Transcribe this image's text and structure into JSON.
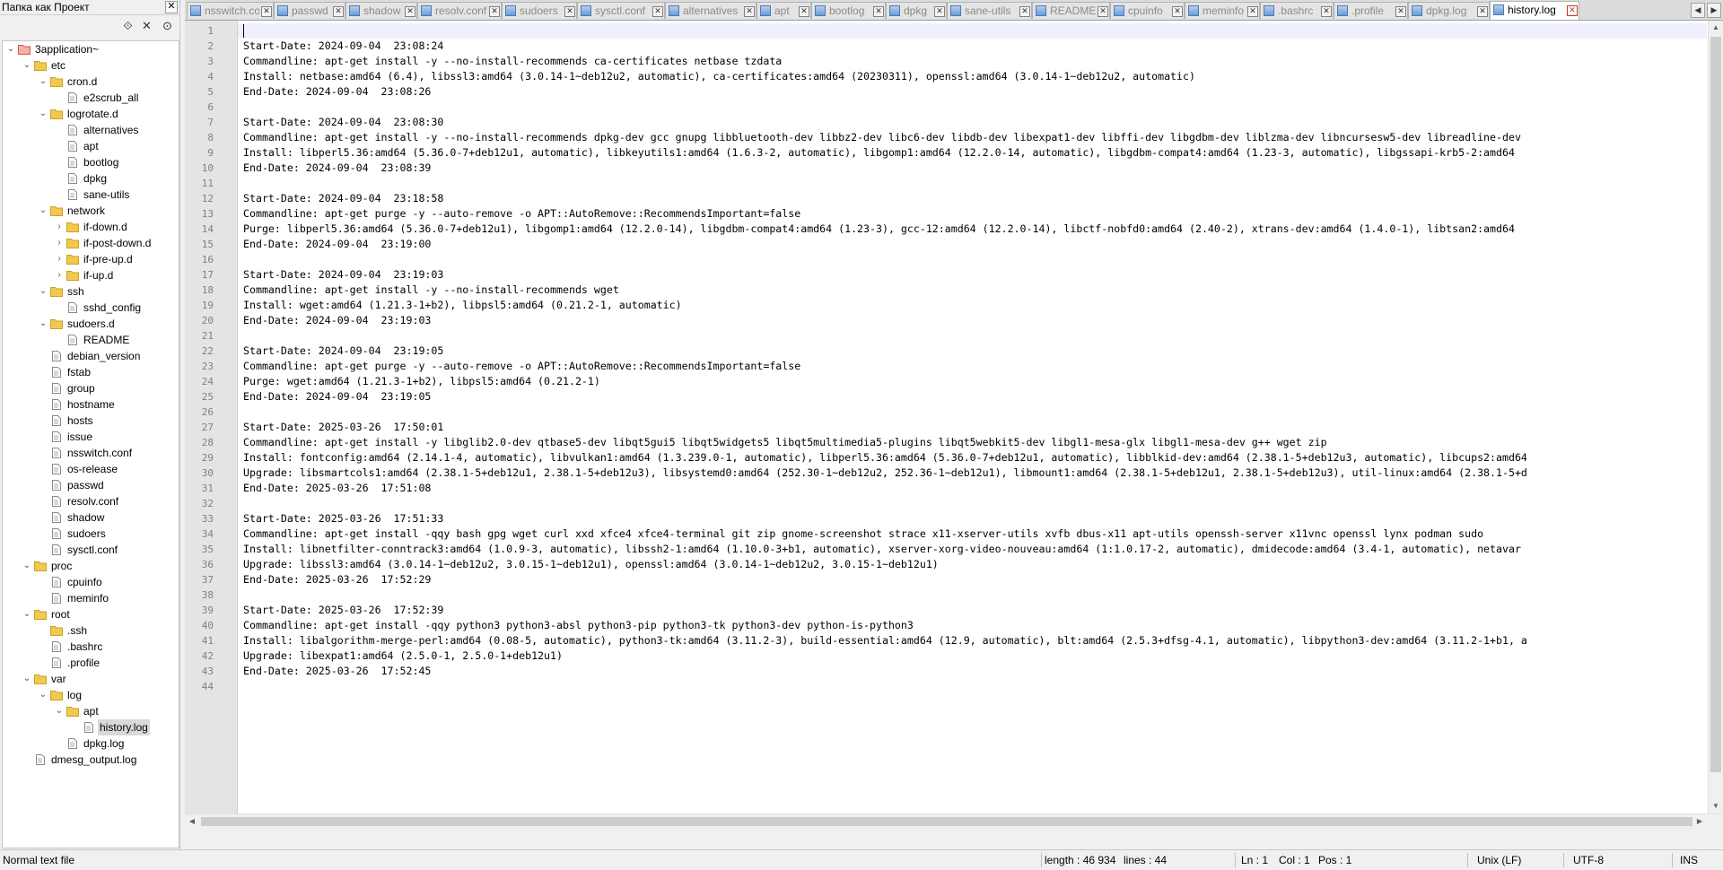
{
  "sidebar": {
    "title": "Папка как Проект",
    "close_glyph": "✕",
    "tree": [
      {
        "label": "3application~",
        "depth": 0,
        "type": "project",
        "toggle": "open"
      },
      {
        "label": "etc",
        "depth": 1,
        "type": "folder",
        "toggle": "open"
      },
      {
        "label": "cron.d",
        "depth": 2,
        "type": "folder",
        "toggle": "open"
      },
      {
        "label": "e2scrub_all",
        "depth": 3,
        "type": "file"
      },
      {
        "label": "logrotate.d",
        "depth": 2,
        "type": "folder",
        "toggle": "open"
      },
      {
        "label": "alternatives",
        "depth": 3,
        "type": "file"
      },
      {
        "label": "apt",
        "depth": 3,
        "type": "file"
      },
      {
        "label": "bootlog",
        "depth": 3,
        "type": "file"
      },
      {
        "label": "dpkg",
        "depth": 3,
        "type": "file"
      },
      {
        "label": "sane-utils",
        "depth": 3,
        "type": "file"
      },
      {
        "label": "network",
        "depth": 2,
        "type": "folder",
        "toggle": "open"
      },
      {
        "label": "if-down.d",
        "depth": 3,
        "type": "folder",
        "toggle": "closed"
      },
      {
        "label": "if-post-down.d",
        "depth": 3,
        "type": "folder",
        "toggle": "closed"
      },
      {
        "label": "if-pre-up.d",
        "depth": 3,
        "type": "folder",
        "toggle": "closed"
      },
      {
        "label": "if-up.d",
        "depth": 3,
        "type": "folder",
        "toggle": "closed"
      },
      {
        "label": "ssh",
        "depth": 2,
        "type": "folder",
        "toggle": "open"
      },
      {
        "label": "sshd_config",
        "depth": 3,
        "type": "file"
      },
      {
        "label": "sudoers.d",
        "depth": 2,
        "type": "folder",
        "toggle": "open"
      },
      {
        "label": "README",
        "depth": 3,
        "type": "file"
      },
      {
        "label": "debian_version",
        "depth": 2,
        "type": "file"
      },
      {
        "label": "fstab",
        "depth": 2,
        "type": "file"
      },
      {
        "label": "group",
        "depth": 2,
        "type": "file"
      },
      {
        "label": "hostname",
        "depth": 2,
        "type": "file"
      },
      {
        "label": "hosts",
        "depth": 2,
        "type": "file"
      },
      {
        "label": "issue",
        "depth": 2,
        "type": "file"
      },
      {
        "label": "nsswitch.conf",
        "depth": 2,
        "type": "file"
      },
      {
        "label": "os-release",
        "depth": 2,
        "type": "file"
      },
      {
        "label": "passwd",
        "depth": 2,
        "type": "file"
      },
      {
        "label": "resolv.conf",
        "depth": 2,
        "type": "file"
      },
      {
        "label": "shadow",
        "depth": 2,
        "type": "file"
      },
      {
        "label": "sudoers",
        "depth": 2,
        "type": "file"
      },
      {
        "label": "sysctl.conf",
        "depth": 2,
        "type": "file"
      },
      {
        "label": "proc",
        "depth": 1,
        "type": "folder",
        "toggle": "open"
      },
      {
        "label": "cpuinfo",
        "depth": 2,
        "type": "file"
      },
      {
        "label": "meminfo",
        "depth": 2,
        "type": "file"
      },
      {
        "label": "root",
        "depth": 1,
        "type": "folder",
        "toggle": "open"
      },
      {
        "label": ".ssh",
        "depth": 2,
        "type": "folder"
      },
      {
        "label": ".bashrc",
        "depth": 2,
        "type": "file"
      },
      {
        "label": ".profile",
        "depth": 2,
        "type": "file"
      },
      {
        "label": "var",
        "depth": 1,
        "type": "folder",
        "toggle": "open"
      },
      {
        "label": "log",
        "depth": 2,
        "type": "folder",
        "toggle": "open"
      },
      {
        "label": "apt",
        "depth": 3,
        "type": "folder",
        "toggle": "open"
      },
      {
        "label": "history.log",
        "depth": 4,
        "type": "file",
        "selected": true
      },
      {
        "label": "dpkg.log",
        "depth": 3,
        "type": "file"
      },
      {
        "label": "dmesg_output.log",
        "depth": 1,
        "type": "file"
      }
    ]
  },
  "tabs": [
    {
      "label": "nsswitch.conf",
      "width": 97
    },
    {
      "label": "passwd",
      "width": 80
    },
    {
      "label": "shadow",
      "width": 80
    },
    {
      "label": "resolv.conf",
      "width": 94
    },
    {
      "label": "sudoers",
      "width": 84
    },
    {
      "label": "sysctl.conf",
      "width": 98
    },
    {
      "label": "alternatives",
      "width": 102
    },
    {
      "label": "apt",
      "width": 61
    },
    {
      "label": "bootlog",
      "width": 83
    },
    {
      "label": "dpkg",
      "width": 68
    },
    {
      "label": "sane-utils",
      "width": 95
    },
    {
      "label": "README",
      "width": 87
    },
    {
      "label": "cpuinfo",
      "width": 83
    },
    {
      "label": "meminfo",
      "width": 84
    },
    {
      "label": ".bashrc",
      "width": 82
    },
    {
      "label": ".profile",
      "width": 83
    },
    {
      "label": "dpkg.log",
      "width": 91
    },
    {
      "label": "history.log",
      "width": 100,
      "active": true
    }
  ],
  "tab_nav": {
    "left": "◀",
    "right": "▶"
  },
  "editor": {
    "lines": [
      "",
      "Start-Date: 2024-09-04  23:08:24",
      "Commandline: apt-get install -y --no-install-recommends ca-certificates netbase tzdata",
      "Install: netbase:amd64 (6.4), libssl3:amd64 (3.0.14-1~deb12u2, automatic), ca-certificates:amd64 (20230311), openssl:amd64 (3.0.14-1~deb12u2, automatic)",
      "End-Date: 2024-09-04  23:08:26",
      "",
      "Start-Date: 2024-09-04  23:08:30",
      "Commandline: apt-get install -y --no-install-recommends dpkg-dev gcc gnupg libbluetooth-dev libbz2-dev libc6-dev libdb-dev libexpat1-dev libffi-dev libgdbm-dev liblzma-dev libncursesw5-dev libreadline-dev",
      "Install: libperl5.36:amd64 (5.36.0-7+deb12u1, automatic), libkeyutils1:amd64 (1.6.3-2, automatic), libgomp1:amd64 (12.2.0-14, automatic), libgdbm-compat4:amd64 (1.23-3, automatic), libgssapi-krb5-2:amd64",
      "End-Date: 2024-09-04  23:08:39",
      "",
      "Start-Date: 2024-09-04  23:18:58",
      "Commandline: apt-get purge -y --auto-remove -o APT::AutoRemove::RecommendsImportant=false",
      "Purge: libperl5.36:amd64 (5.36.0-7+deb12u1), libgomp1:amd64 (12.2.0-14), libgdbm-compat4:amd64 (1.23-3), gcc-12:amd64 (12.2.0-14), libctf-nobfd0:amd64 (2.40-2), xtrans-dev:amd64 (1.4.0-1), libtsan2:amd64",
      "End-Date: 2024-09-04  23:19:00",
      "",
      "Start-Date: 2024-09-04  23:19:03",
      "Commandline: apt-get install -y --no-install-recommends wget",
      "Install: wget:amd64 (1.21.3-1+b2), libpsl5:amd64 (0.21.2-1, automatic)",
      "End-Date: 2024-09-04  23:19:03",
      "",
      "Start-Date: 2024-09-04  23:19:05",
      "Commandline: apt-get purge -y --auto-remove -o APT::AutoRemove::RecommendsImportant=false",
      "Purge: wget:amd64 (1.21.3-1+b2), libpsl5:amd64 (0.21.2-1)",
      "End-Date: 2024-09-04  23:19:05",
      "",
      "Start-Date: 2025-03-26  17:50:01",
      "Commandline: apt-get install -y libglib2.0-dev qtbase5-dev libqt5gui5 libqt5widgets5 libqt5multimedia5-plugins libqt5webkit5-dev libgl1-mesa-glx libgl1-mesa-dev g++ wget zip",
      "Install: fontconfig:amd64 (2.14.1-4, automatic), libvulkan1:amd64 (1.3.239.0-1, automatic), libperl5.36:amd64 (5.36.0-7+deb12u1, automatic), libblkid-dev:amd64 (2.38.1-5+deb12u3, automatic), libcups2:amd64",
      "Upgrade: libsmartcols1:amd64 (2.38.1-5+deb12u1, 2.38.1-5+deb12u3), libsystemd0:amd64 (252.30-1~deb12u2, 252.36-1~deb12u1), libmount1:amd64 (2.38.1-5+deb12u1, 2.38.1-5+deb12u3), util-linux:amd64 (2.38.1-5+d",
      "End-Date: 2025-03-26  17:51:08",
      "",
      "Start-Date: 2025-03-26  17:51:33",
      "Commandline: apt-get install -qqy bash gpg wget curl xxd xfce4 xfce4-terminal git zip gnome-screenshot strace x11-xserver-utils xvfb dbus-x11 apt-utils openssh-server x11vnc openssl lynx podman sudo",
      "Install: libnetfilter-conntrack3:amd64 (1.0.9-3, automatic), libssh2-1:amd64 (1.10.0-3+b1, automatic), xserver-xorg-video-nouveau:amd64 (1:1.0.17-2, automatic), dmidecode:amd64 (3.4-1, automatic), netavar",
      "Upgrade: libssl3:amd64 (3.0.14-1~deb12u2, 3.0.15-1~deb12u1), openssl:amd64 (3.0.14-1~deb12u2, 3.0.15-1~deb12u1)",
      "End-Date: 2025-03-26  17:52:29",
      "",
      "Start-Date: 2025-03-26  17:52:39",
      "Commandline: apt-get install -qqy python3 python3-absl python3-pip python3-tk python3-dev python-is-python3",
      "Install: libalgorithm-merge-perl:amd64 (0.08-5, automatic), python3-tk:amd64 (3.11.2-3), build-essential:amd64 (12.9, automatic), blt:amd64 (2.5.3+dfsg-4.1, automatic), libpython3-dev:amd64 (3.11.2-1+b1, a",
      "Upgrade: libexpat1:amd64 (2.5.0-1, 2.5.0-1+deb12u1)",
      "End-Date: 2025-03-26  17:52:45",
      ""
    ]
  },
  "status": {
    "file_type": "Normal text file",
    "length": "length : 46 934",
    "lines": "lines : 44",
    "ln": "Ln : 1",
    "col": "Col : 1",
    "pos": "Pos : 1",
    "eol": "Unix (LF)",
    "encoding": "UTF-8",
    "mode": "INS"
  },
  "colors": {
    "folder": "#f2c94c",
    "file_border": "#8a8a8a",
    "project_icon": "#d9534f",
    "current_line": "#eef0ff",
    "gutter": "#e4e4e4"
  }
}
